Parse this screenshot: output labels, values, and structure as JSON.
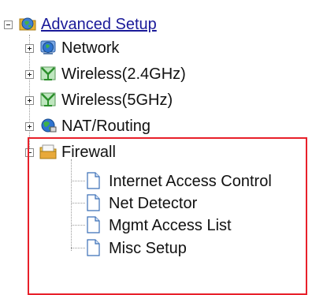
{
  "tree": {
    "root": {
      "label": "Advanced Setup",
      "icon": "globe-folder-icon"
    },
    "children": [
      {
        "label": "Network",
        "icon": "globe-icon"
      },
      {
        "label": "Wireless(2.4GHz)",
        "icon": "wireless-antenna-icon"
      },
      {
        "label": "Wireless(5GHz)",
        "icon": "wireless-antenna-icon"
      },
      {
        "label": "NAT/Routing",
        "icon": "network-globe-icon"
      },
      {
        "label": "Firewall",
        "icon": "lock-folder-icon",
        "items": [
          {
            "label": "Internet Access Control",
            "icon": "page-icon"
          },
          {
            "label": "Net Detector",
            "icon": "page-icon"
          },
          {
            "label": "Mgmt Access List",
            "icon": "page-icon"
          },
          {
            "label": "Misc Setup",
            "icon": "page-icon"
          }
        ]
      }
    ]
  },
  "highlight_color": "#e8202a"
}
